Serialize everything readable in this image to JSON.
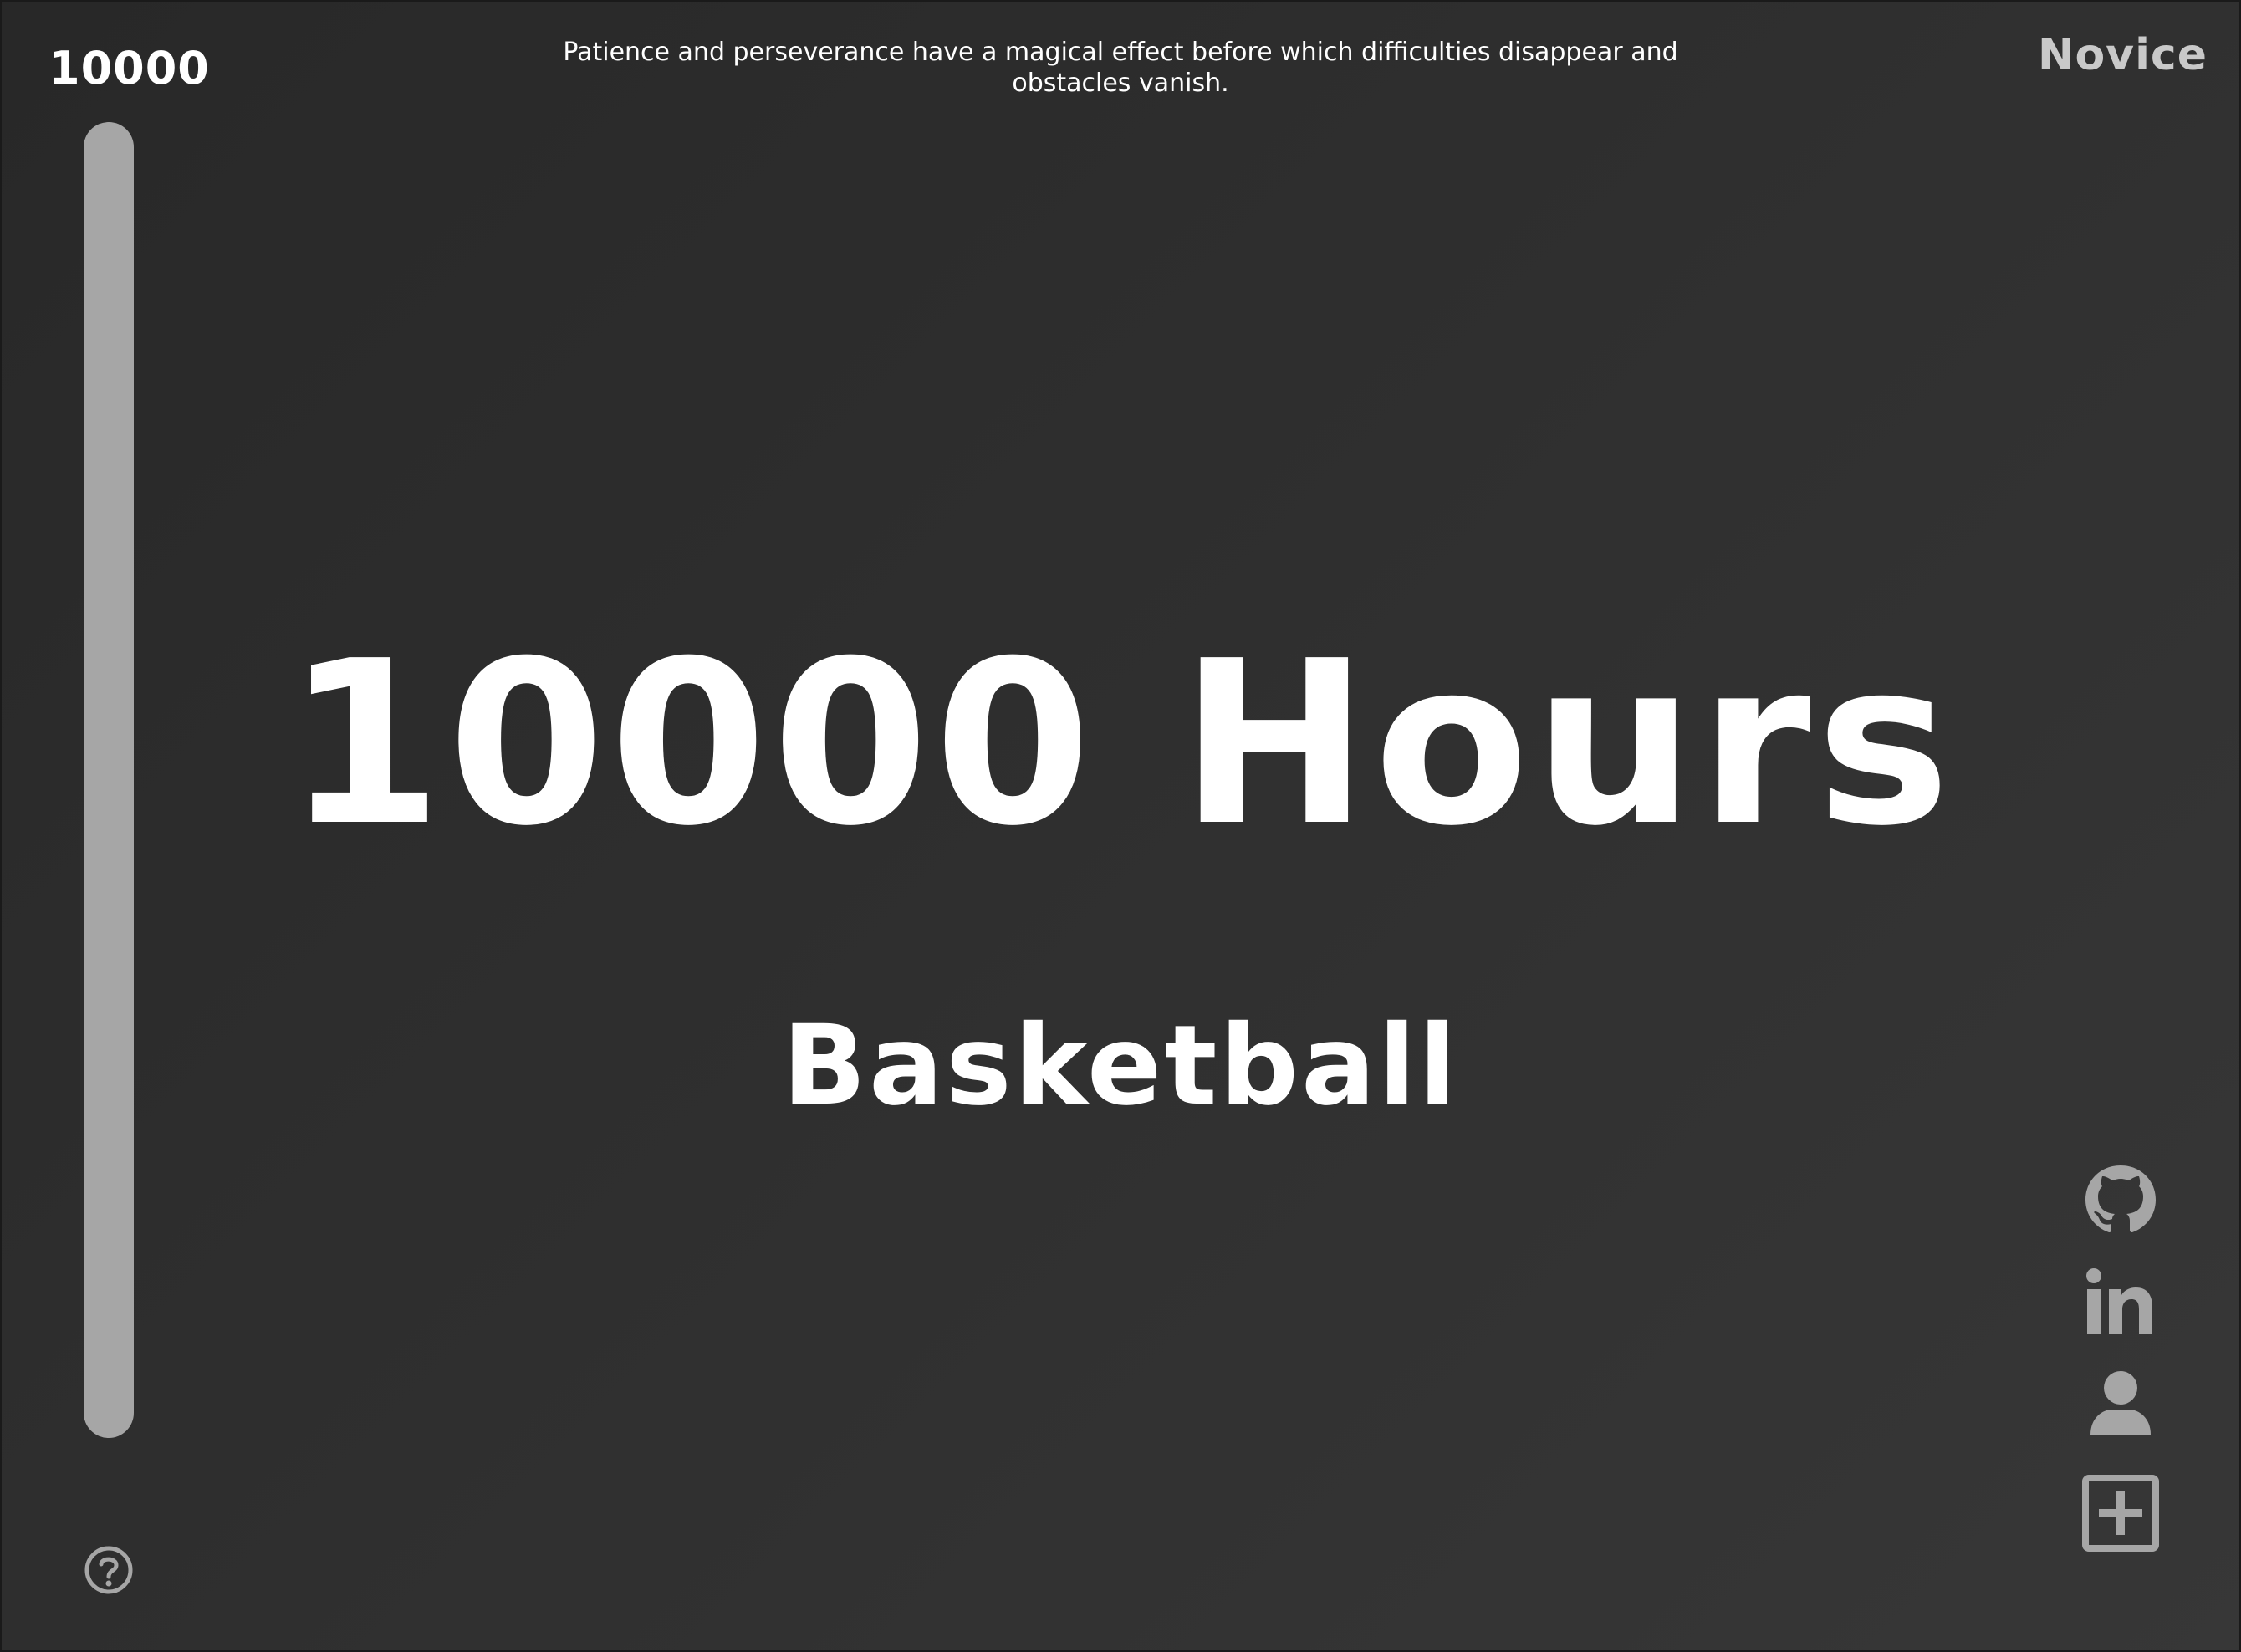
{
  "header": {
    "goal_hours": "10000",
    "quote": "Patience and perseverance have a magical effect before which difficulties disappear and obstacles vanish.",
    "rank": "Novice"
  },
  "main": {
    "title": "10000 Hours",
    "skill": "Basketball"
  },
  "progress": {
    "fraction": 0.0
  },
  "icons": {
    "help": "help-icon",
    "github": "github-icon",
    "linkedin": "linkedin-icon",
    "profile": "profile-icon",
    "add": "add-icon"
  },
  "colors": {
    "background": "#2d2d2d",
    "text": "#ffffff",
    "muted_icon": "#a6a6a6",
    "rank_text": "#c9c9c9",
    "progress_track": "#a6a6a6",
    "progress_fill": "#f2f2f2"
  }
}
